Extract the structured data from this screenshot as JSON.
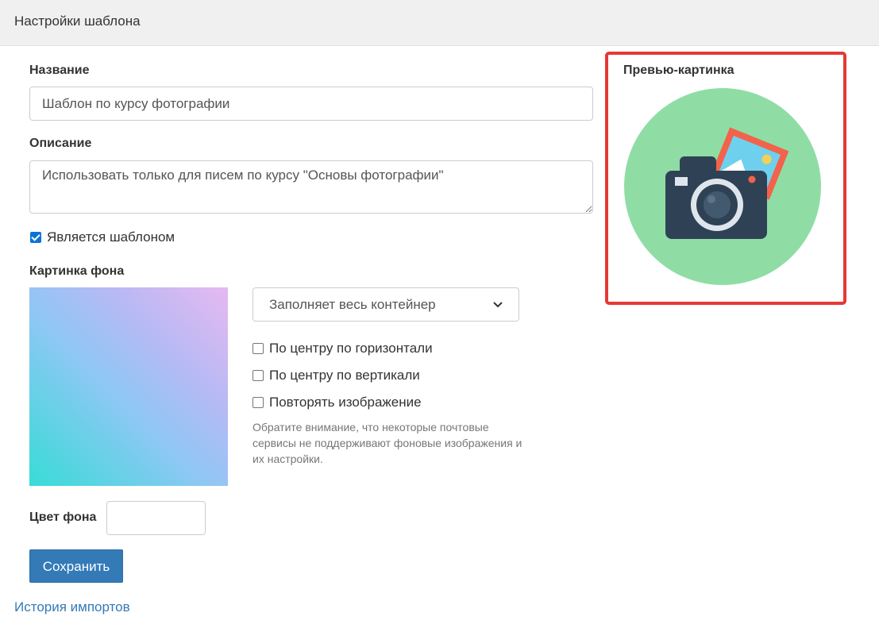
{
  "header": {
    "title": "Настройки шаблона"
  },
  "form": {
    "name_label": "Название",
    "name_value": "Шаблон по курсу фотографии",
    "description_label": "Описание",
    "description_value": "Использовать только для писем по курсу \"Основы фотографии\"",
    "is_template_label": "Является шаблоном",
    "is_template_checked": true,
    "background_image_label": "Картинка фона",
    "background_gradient_colors": [
      "#37dcd7",
      "#8fc7f4",
      "#b8b9f4",
      "#e6b9f0"
    ],
    "fit_select_value": "Заполняет весь контейнер",
    "center_horizontal_label": "По центру по горизонтали",
    "center_vertical_label": "По центру по вертикали",
    "repeat_image_label": "Повторять изображение",
    "note": "Обратите внимание, что некоторые почтовые сервисы не поддерживают фоновые изображения и их настройки.",
    "background_color_label": "Цвет фона",
    "background_color_value": "",
    "save_label": "Сохранить"
  },
  "links": {
    "import_history": "История импортов"
  },
  "preview": {
    "label": "Превью-картинка",
    "icon": "camera-icon",
    "highlight_color": "#e53935"
  },
  "colors": {
    "primary": "#337ab7",
    "header_bg": "#f0f0f0",
    "preview_circle": "#8fdda5",
    "camera_body": "#2f4255"
  }
}
